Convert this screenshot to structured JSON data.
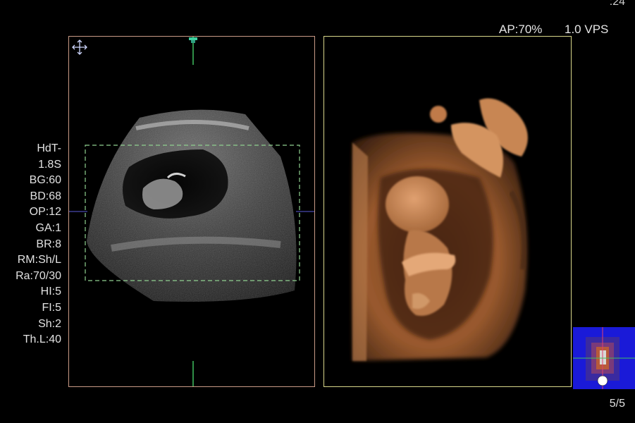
{
  "header": {
    "top_value": ":24",
    "acoustic_power": "AP:70%",
    "volume_rate": "1.0 VPS"
  },
  "params": [
    "HdT-",
    "1.8S",
    "BG:60",
    "BD:68",
    "OP:12",
    "GA:1",
    "BR:8",
    "RM:Sh/L",
    "Ra:70/30",
    "HI:5",
    "FI:5",
    "Sh:2",
    "Th.L:40"
  ],
  "pager": "5/5",
  "colors": {
    "left_frame": "#c99a86",
    "right_frame": "#d8d68a",
    "roi_box": "#8fd08f",
    "render_tone": "#c07a48",
    "orientation_bg": "#1a1ad8"
  },
  "icons": {
    "move": "crosshair-move-icon",
    "marker": "top-marker-icon",
    "orientation": "orientation-cube-icon"
  }
}
